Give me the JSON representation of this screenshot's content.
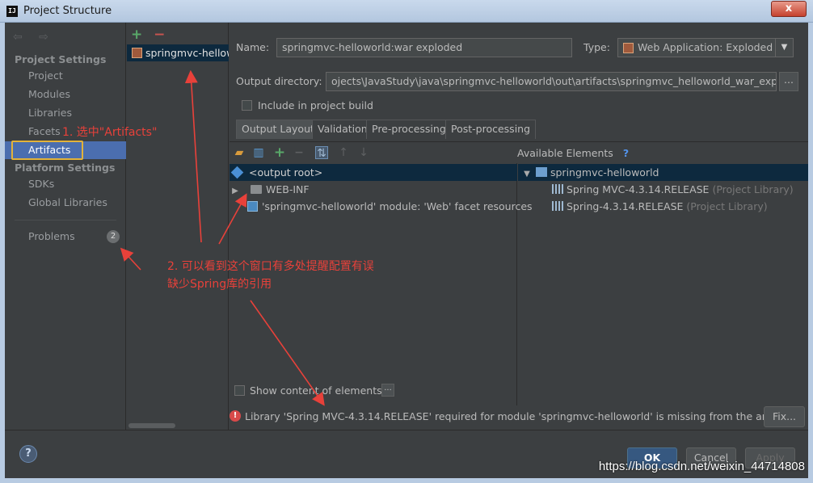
{
  "window": {
    "title": "Project Structure",
    "app_icon_text": "IJ",
    "close_glyph": "x"
  },
  "nav": {
    "back_forward": "⇦ ⇨",
    "project_settings_label": "Project Settings",
    "project_items": [
      "Project",
      "Modules",
      "Libraries",
      "Facets",
      "Artifacts"
    ],
    "selected_item": "Artifacts",
    "platform_settings_label": "Platform Settings",
    "platform_items": [
      "SDKs",
      "Global Libraries"
    ],
    "problems_label": "Problems",
    "problems_count": "2"
  },
  "artifacts": {
    "add_glyph": "+",
    "remove_glyph": "−",
    "items": [
      "springmvc-helloworld:war exploded"
    ]
  },
  "form": {
    "name_label": "Name:",
    "name_value": "springmvc-helloworld:war exploded",
    "type_label": "Type:",
    "type_value": "Web Application: Exploded",
    "output_dir_label": "Output directory:",
    "output_dir_value": "ojects\\JavaStudy\\java\\springmvc-helloworld\\out\\artifacts\\springmvc_helloworld_war_exploded",
    "browse_label": "...",
    "include_build_label": "Include in project build"
  },
  "tabs": [
    "Output Layout",
    "Validation",
    "Pre-processing",
    "Post-processing"
  ],
  "layout": {
    "available_title": "Available Elements",
    "help_glyph": "?",
    "left_tree": [
      {
        "label": "<output root>"
      },
      {
        "label": "WEB-INF"
      },
      {
        "label": "'springmvc-helloworld' module: 'Web' facet resources"
      }
    ],
    "right_tree": [
      {
        "label": "springmvc-helloworld",
        "suffix": ""
      },
      {
        "label": "Spring MVC-4.3.14.RELEASE",
        "suffix": "(Project Library)"
      },
      {
        "label": "Spring-4.3.14.RELEASE",
        "suffix": "(Project Library)"
      }
    ],
    "show_content_label": "Show content of elements",
    "show_content_btn": "..."
  },
  "error": {
    "message": "Library 'Spring MVC-4.3.14.RELEASE' required for module 'springmvc-helloworld' is missing from the artifact",
    "fix_label": "Fix..."
  },
  "buttons": {
    "help": "?",
    "ok": "OK",
    "cancel": "Cancel",
    "apply": "Apply"
  },
  "annotations": {
    "note1": "1. 选中\"Artifacts\"",
    "note2_line1": "2. 可以看到这个窗口有多处提醒配置有误",
    "note2_line2": "缺少Spring库的引用",
    "color": "#e8413a"
  },
  "watermark": "https://blog.csdn.net/weixin_44714808"
}
